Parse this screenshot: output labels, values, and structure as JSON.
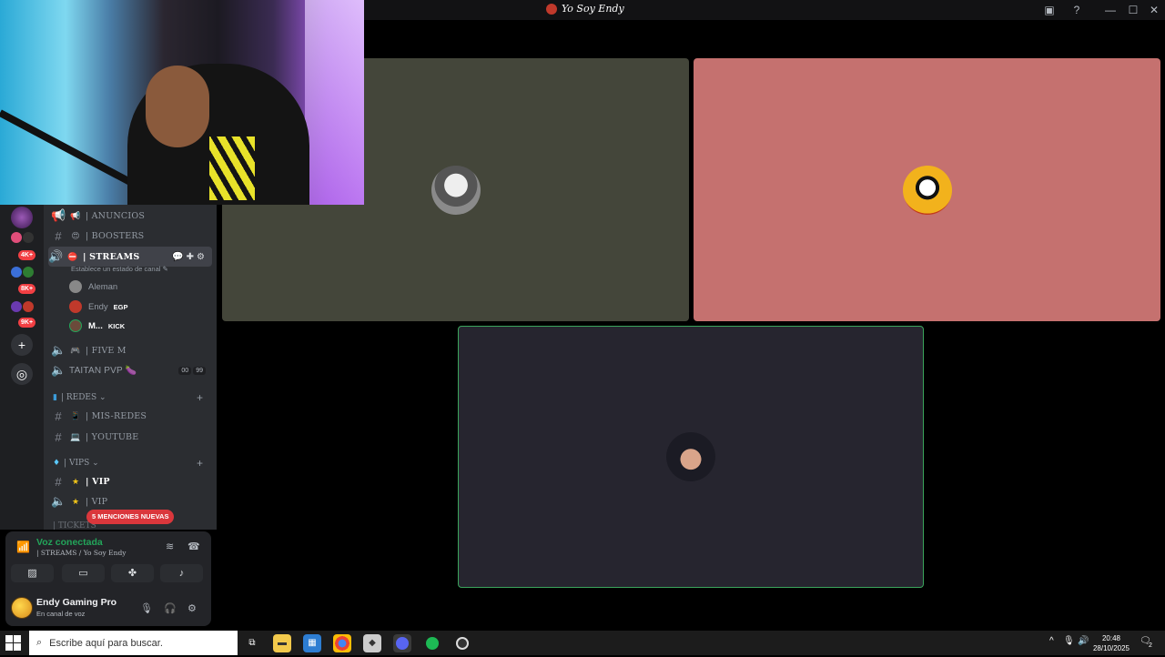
{
  "window": {
    "title": "Yo Soy Endy"
  },
  "rail": {
    "badges": [
      "4K+",
      "8K+",
      "9K+"
    ],
    "add_label": "+",
    "explore_label": "◎"
  },
  "channels": [
    {
      "emoji": "📢",
      "name": "| ANUNCIOS"
    },
    {
      "emoji": "😍",
      "name": "| BOOSTERS"
    },
    {
      "emoji": "⛔",
      "name": "| STREAMS"
    },
    {
      "emoji": "🎮",
      "name": "| FIVE M"
    },
    {
      "emoji": "",
      "name": "TAITAN PVP 🍆"
    },
    {
      "emoji": "📱",
      "name": "| MIS-REDES"
    },
    {
      "emoji": "💻",
      "name": "| YOUTUBE"
    },
    {
      "emoji": "★",
      "name": "| VIP"
    },
    {
      "emoji": "★",
      "name": "| VIP"
    }
  ],
  "streams_status": "Establece un estado de canal ✎",
  "voice_users": [
    {
      "name": "Aleman",
      "tag": ""
    },
    {
      "name": "Endy",
      "tag": "EGP"
    },
    {
      "name": "M...",
      "tag": "KICK"
    }
  ],
  "taitan_counts": [
    "00",
    "99"
  ],
  "categories": {
    "redes": "| REDES ⌄",
    "vips": "| VIPS ⌄",
    "tickets": "| TICKETS"
  },
  "mentions": "5 MENCIONES NUEVAS",
  "voice_panel": {
    "title": "Voz conectada",
    "subtitle": "| STREAMS / Yo Soy Endy"
  },
  "user_panel": {
    "name": "Endy Gaming Pro",
    "status": "En canal de voz"
  },
  "taskbar": {
    "search_placeholder": "Escribe aquí para buscar.",
    "time": "20:48",
    "date": "28/10/2025",
    "notif_count": "2"
  },
  "colors": {
    "tile1": "#44463a",
    "tile2": "#c5716f",
    "tile3": "#26252f",
    "speaking_border": "#3ba55c"
  }
}
